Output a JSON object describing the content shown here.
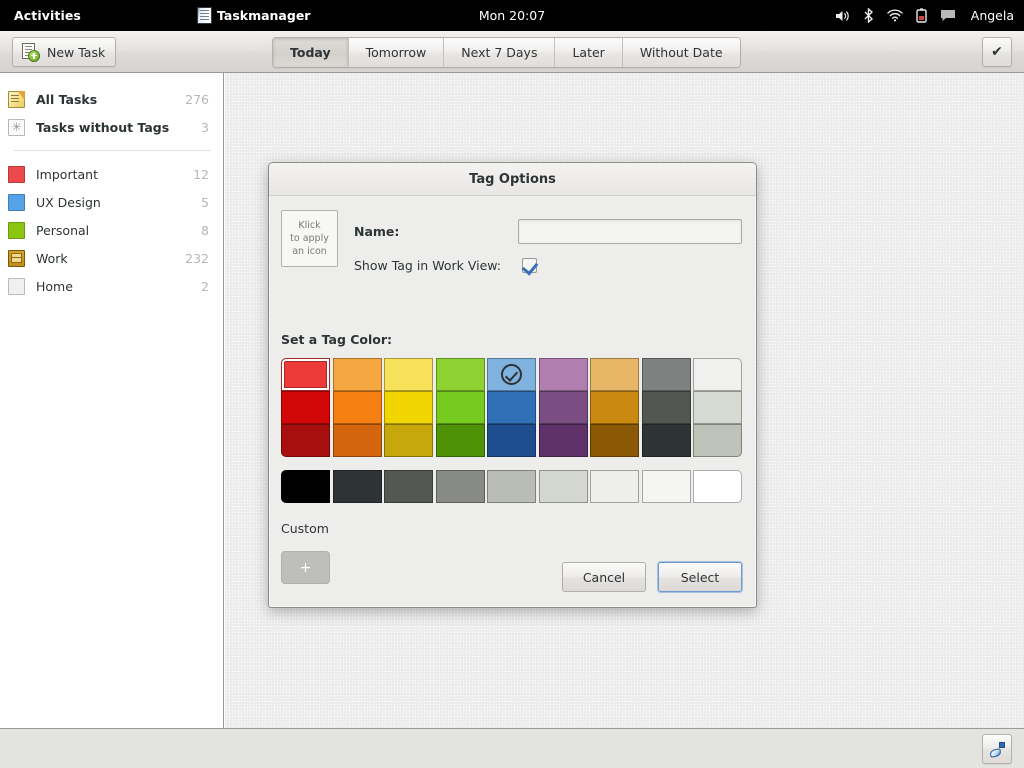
{
  "topbar": {
    "activities": "Activities",
    "app_name": "Taskmanager",
    "app_icon": "document-icon",
    "clock": "Mon 20:07",
    "user": "Angela",
    "tray_icons": [
      "volume-icon",
      "bluetooth-icon",
      "wifi-icon",
      "battery-icon",
      "message-icon"
    ]
  },
  "toolbar": {
    "new_task_label": "New Task",
    "new_task_icon": "new-document-icon",
    "check_icon": "checkmark-icon",
    "tabs": [
      {
        "label": "Today",
        "active": true
      },
      {
        "label": "Tomorrow",
        "active": false
      },
      {
        "label": "Next 7 Days",
        "active": false
      },
      {
        "label": "Later",
        "active": false
      },
      {
        "label": "Without Date",
        "active": false
      }
    ]
  },
  "sidebar": {
    "groups": [
      {
        "items": [
          {
            "label": "All Tasks",
            "count": "276",
            "icon": "notepad-pencil-icon",
            "bold": true
          },
          {
            "label": "Tasks without Tags",
            "count": "3",
            "icon": "asterisk-icon",
            "bold": true
          }
        ]
      },
      {
        "items": [
          {
            "label": "Important",
            "count": "12",
            "icon": "color-swatch",
            "color": "#ec4a4a"
          },
          {
            "label": "UX Design",
            "count": "5",
            "icon": "color-swatch",
            "color": "#54a3e8"
          },
          {
            "label": "Personal",
            "count": "8",
            "icon": "color-swatch",
            "color": "#8ac50f"
          },
          {
            "label": "Work",
            "count": "232",
            "icon": "drawer-icon"
          },
          {
            "label": "Home",
            "count": "2",
            "icon": "color-swatch",
            "color": "#f0f0ee"
          }
        ]
      }
    ]
  },
  "bottombar": {
    "pen_icon": "pen-edit-icon"
  },
  "dialog": {
    "title": "Tag Options",
    "icon_button": {
      "line1": "Klick",
      "line2": "to apply",
      "line3": "an icon"
    },
    "name_label": "Name:",
    "name_value": "",
    "name_placeholder": "",
    "show_tag_label": "Show Tag in Work View:",
    "show_tag_checked": true,
    "palette_label": "Set a Tag Color:",
    "custom_label": "Custom",
    "custom_add_label": "+",
    "cancel_label": "Cancel",
    "select_label": "Select",
    "colors": [
      [
        "#ee3b39",
        "#f5a841",
        "#f7e159",
        "#8ed232",
        "#7fb2de",
        "#b07fb0",
        "#e7b667",
        "#7f8080",
        "#f0f0ee"
      ],
      [
        "#d10708",
        "#f57f13",
        "#f0d500",
        "#77ca20",
        "#3070b6",
        "#7a4e82",
        "#ca8a12",
        "#535653",
        "#d6dad2"
      ],
      [
        "#a70f0e",
        "#d4650f",
        "#c7a80c",
        "#509206",
        "#1f4e8f",
        "#5e3268",
        "#8b5906",
        "#2e3436",
        "#bec2b9"
      ]
    ],
    "grays": [
      "#000000",
      "#2e3436",
      "#555753",
      "#888a85",
      "#babdb6",
      "#d3d7cf",
      "#eeeeec",
      "#f5f5f4",
      "#ffffff"
    ],
    "selected_color": {
      "row": 0,
      "col": 4
    },
    "hover_color": {
      "row": 0,
      "col": 0
    }
  }
}
